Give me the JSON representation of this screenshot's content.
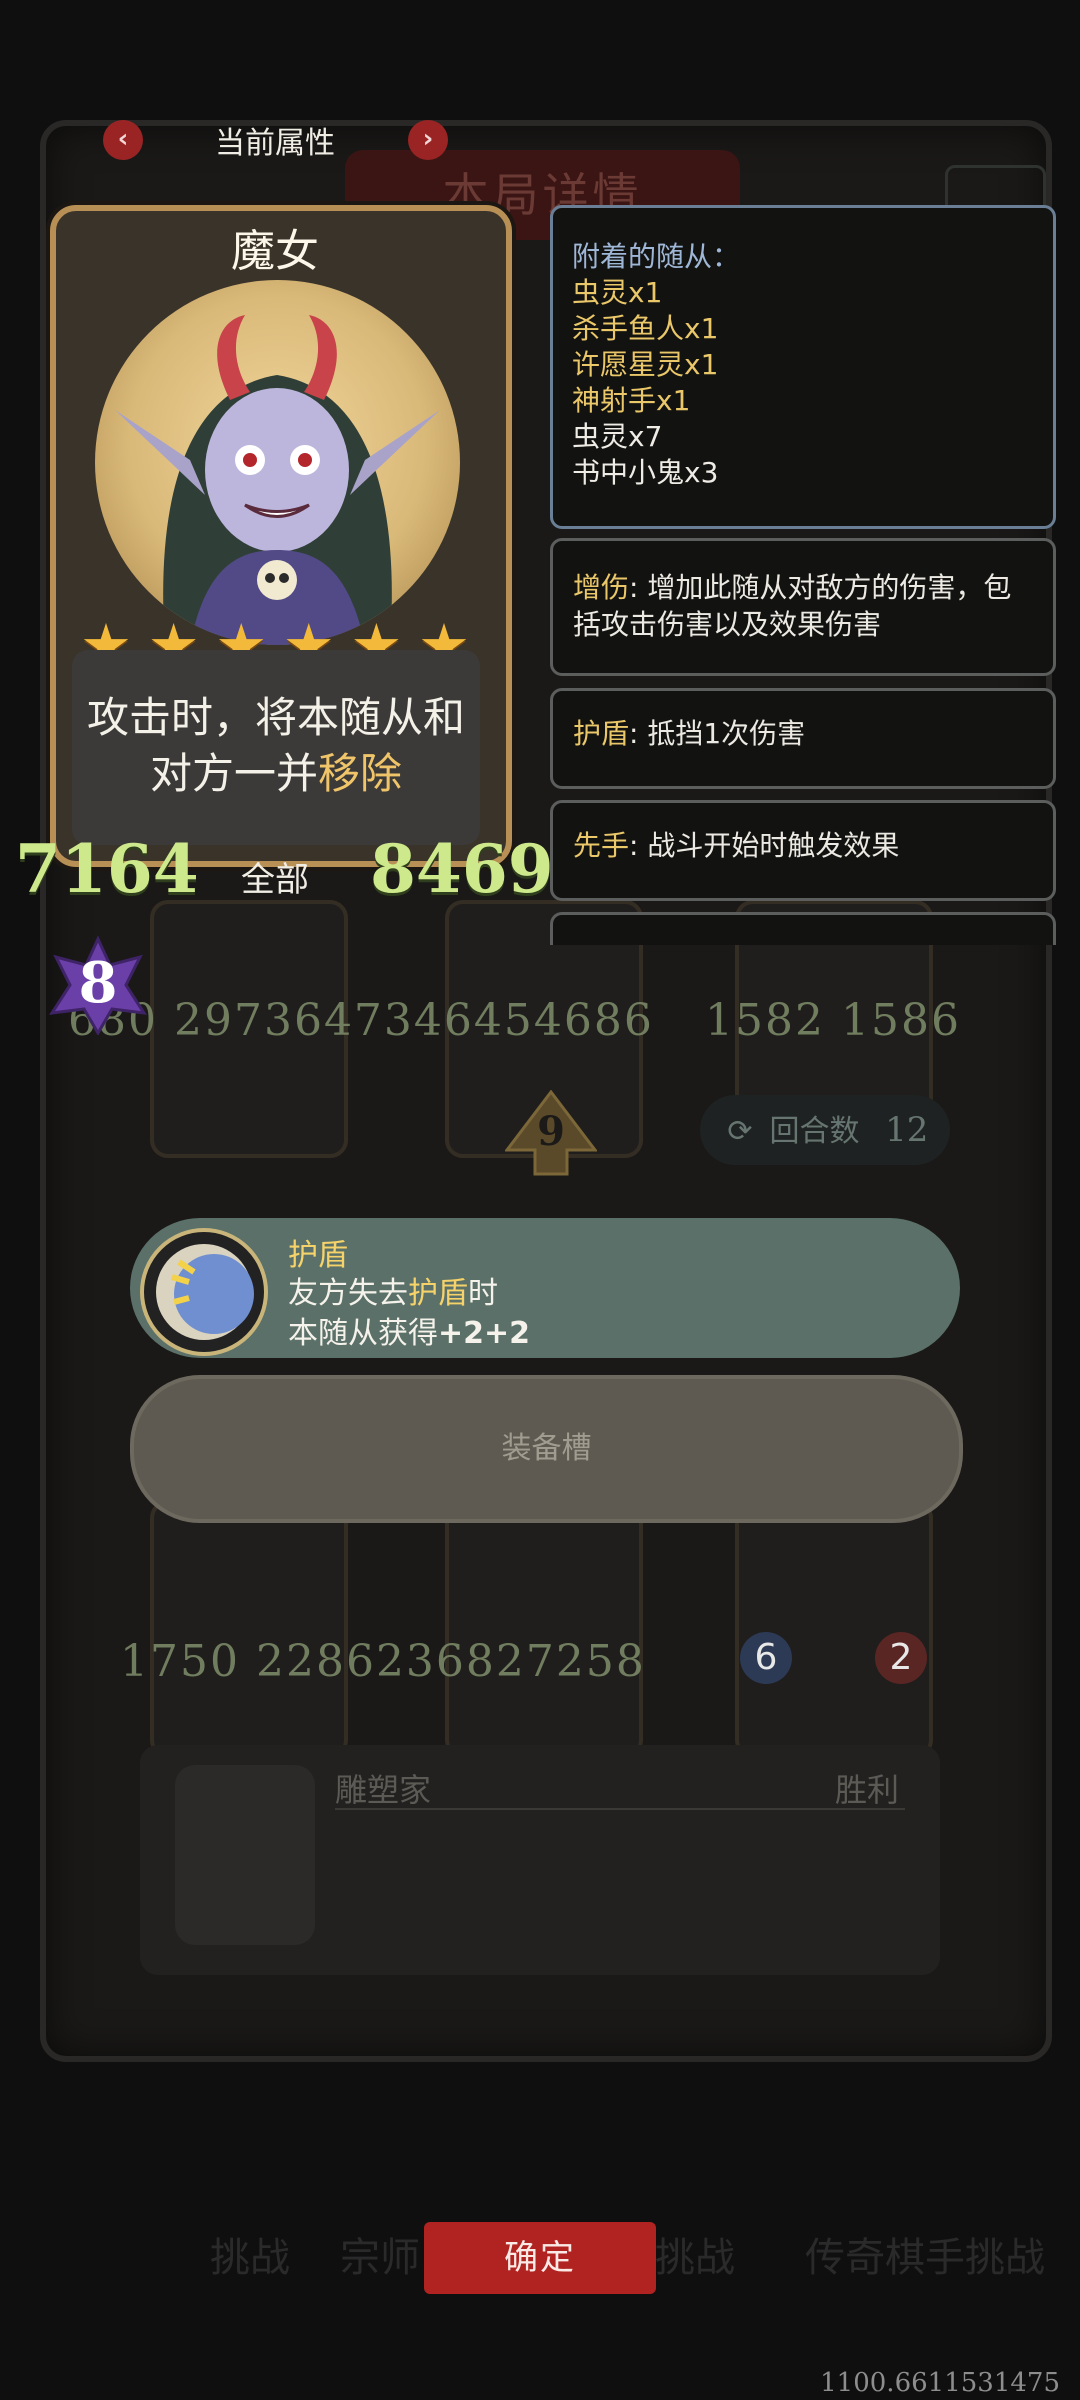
{
  "header": {
    "title": "当前属性",
    "prev_icon": "chevron-left-icon",
    "next_icon": "chevron-right-icon"
  },
  "background": {
    "board_title": "本局详情",
    "numbers_row1": "680 2973647346454686",
    "numbers_row1b": "1582 1586",
    "numbers_row2": "1750 2286236827258",
    "small_stats": [
      "6",
      "2"
    ],
    "tier_arrow_number": "9",
    "round_label": "回合数",
    "round_value": "12",
    "sculptor_name": "雕塑家",
    "sculptor_result": "胜利",
    "bottom_nav_blurred": [
      "挑战",
      "宗师",
      "挑战",
      "传奇棋手挑战"
    ]
  },
  "card": {
    "name": "魔女",
    "stars": 6,
    "description_before": "攻击时，将本随从和对方一并",
    "description_highlight": "移除",
    "attack": "7164",
    "scope_label": "全部",
    "health": "8469",
    "tier": "8"
  },
  "attached": {
    "title": "附着的随从：",
    "items": [
      {
        "text": "虫灵x1",
        "color": "gold"
      },
      {
        "text": "杀手鱼人x1",
        "color": "gold"
      },
      {
        "text": "许愿星灵x1",
        "color": "gold"
      },
      {
        "text": "神射手x1",
        "color": "gold"
      },
      {
        "text": "虫灵x7",
        "color": "white"
      },
      {
        "text": "书中小鬼x3",
        "color": "white"
      }
    ]
  },
  "keywords": [
    {
      "name": "增伤",
      "desc": "增加此随从对敌方的伤害，包括攻击伤害以及效果伤害"
    },
    {
      "name": "护盾",
      "desc": "抵挡1次伤害"
    },
    {
      "name": "先手",
      "desc": "战斗开始时触发效果"
    }
  ],
  "ability": {
    "title": "护盾",
    "line1_before": "友方失去",
    "line1_highlight": "护盾",
    "line1_after": "时",
    "line2_before": "本随从获得",
    "line2_highlight": "+2+2"
  },
  "equip_slot": "装备槽",
  "confirm_label": "确定",
  "version_text": "1100.6611531475",
  "colors": {
    "accent_gold": "#eac768",
    "confirm_red": "#b12320",
    "stat_green": "#cde98b"
  }
}
